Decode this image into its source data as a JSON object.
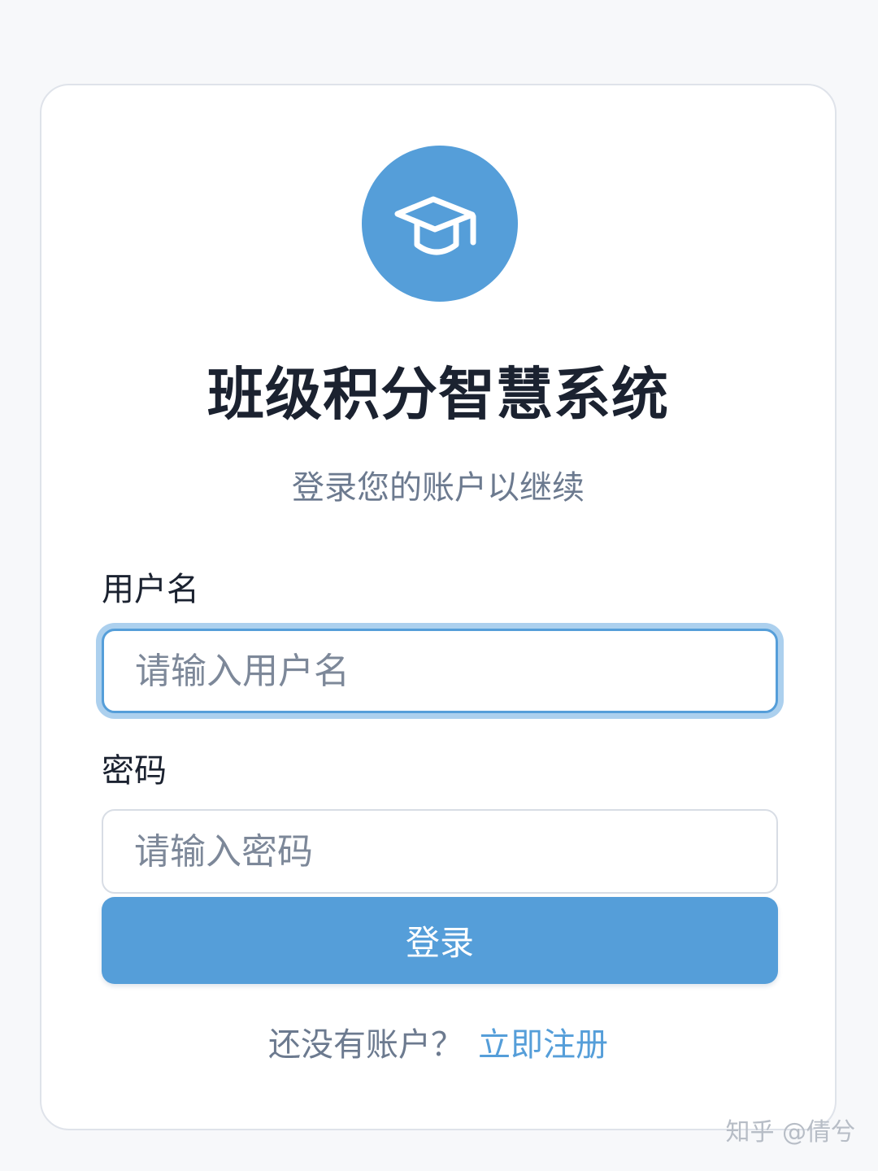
{
  "app": {
    "logo_icon": "graduation-cap-icon",
    "title": "班级积分智慧系统",
    "subtitle": "登录您的账户以继续"
  },
  "form": {
    "username": {
      "label": "用户名",
      "placeholder": "请输入用户名",
      "value": ""
    },
    "password": {
      "label": "密码",
      "placeholder": "请输入密码",
      "value": ""
    },
    "submit_label": "登录"
  },
  "footer": {
    "prompt": "还没有账户？",
    "register_link": "立即注册"
  },
  "watermark": "知乎 @倩兮",
  "colors": {
    "accent": "#559ed9",
    "title": "#1b2230",
    "muted": "#6c7a8f",
    "background": "#f7f8fa"
  }
}
